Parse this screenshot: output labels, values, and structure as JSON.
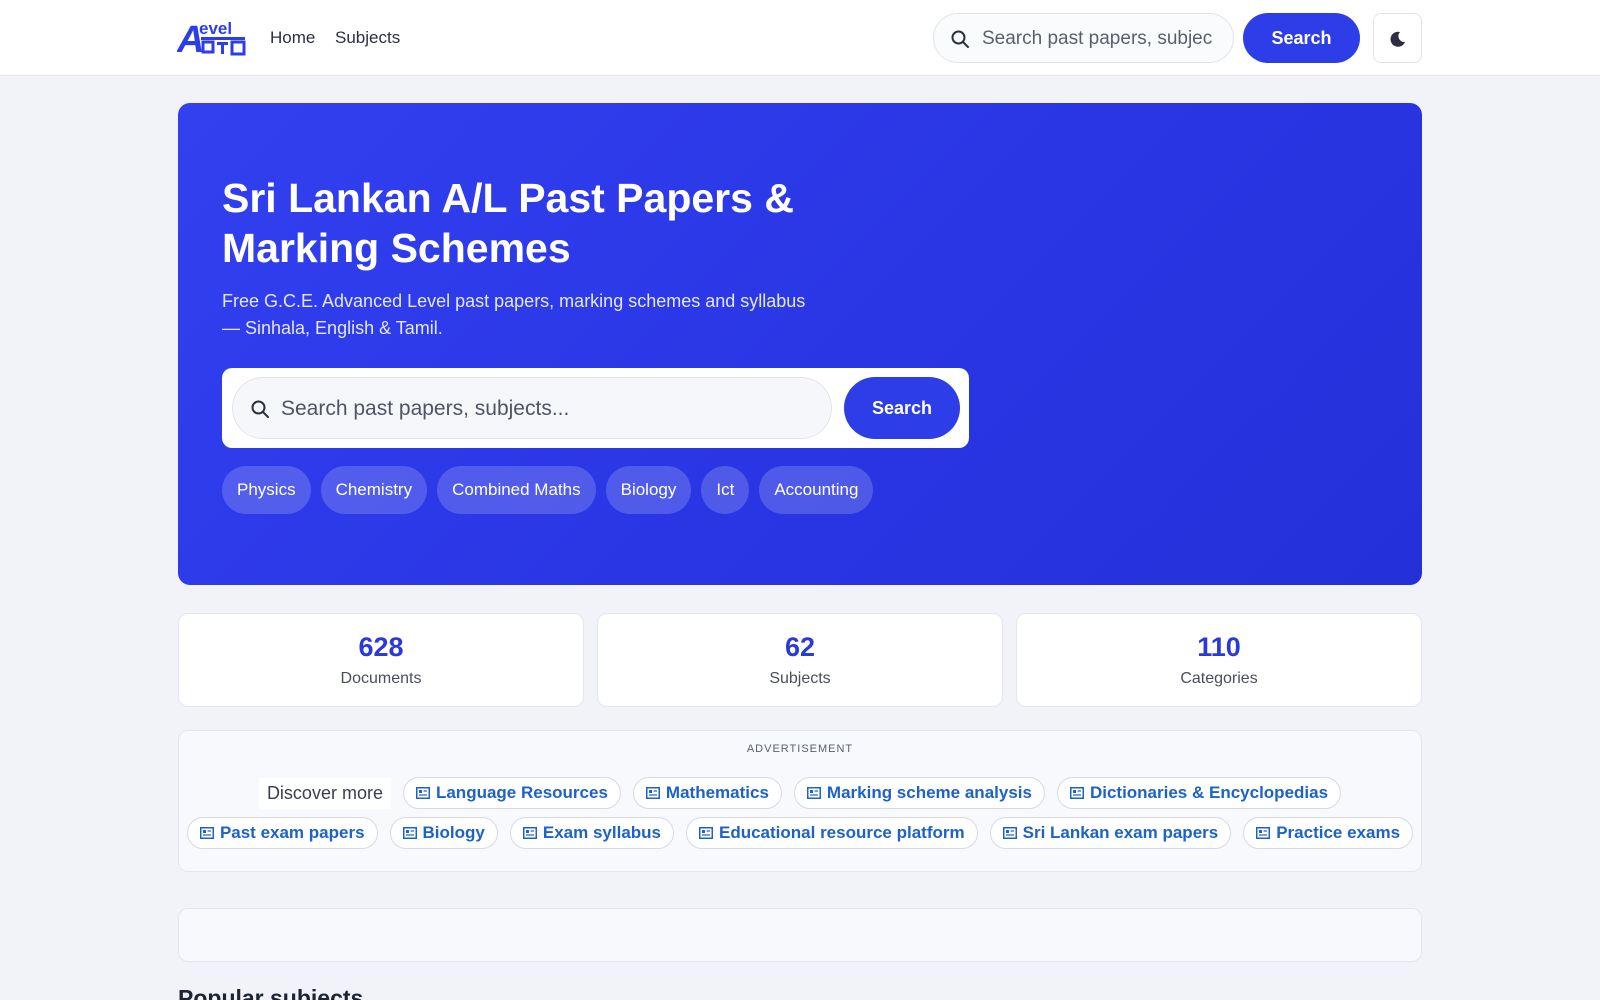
{
  "header": {
    "logo_alt": "A Level 문",
    "nav": [
      {
        "label": "Home"
      },
      {
        "label": "Subjects"
      }
    ],
    "search_placeholder": "Search past papers, subjects...",
    "search_button": "Search",
    "theme_icon": "moon-icon"
  },
  "hero": {
    "title_line1": "Sri Lankan A/L Past Papers &",
    "title_line2": "Marking Schemes",
    "subtitle_line1": "Free G.C.E. Advanced Level past papers, marking schemes and syllabus",
    "subtitle_line2": "— Sinhala, English & Tamil.",
    "search_placeholder": "Search past papers, subjects...",
    "search_button": "Search",
    "chips": [
      "Physics",
      "Chemistry",
      "Combined Maths",
      "Biology",
      "Ict",
      "Accounting"
    ]
  },
  "stats": [
    {
      "value": "628",
      "label": "Documents"
    },
    {
      "value": "62",
      "label": "Subjects"
    },
    {
      "value": "110",
      "label": "Categories"
    }
  ],
  "ad": {
    "label": "ADVERTISEMENT",
    "discover": "Discover more",
    "row1": [
      "Language Resources",
      "Mathematics",
      "Marking scheme analysis",
      "Dictionaries & Encyclopedias"
    ],
    "row2": [
      "Past exam papers",
      "Biology",
      "Exam syllabus",
      "Educational resource platform",
      "Sri Lankan exam papers",
      "Practice exams"
    ]
  },
  "popular": {
    "heading": "Popular subjects"
  },
  "colors": {
    "accent": "#2d3ee8",
    "hero_bg": "#2a36e4",
    "link": "#1d62c7",
    "stat_number": "#2b39d6"
  }
}
